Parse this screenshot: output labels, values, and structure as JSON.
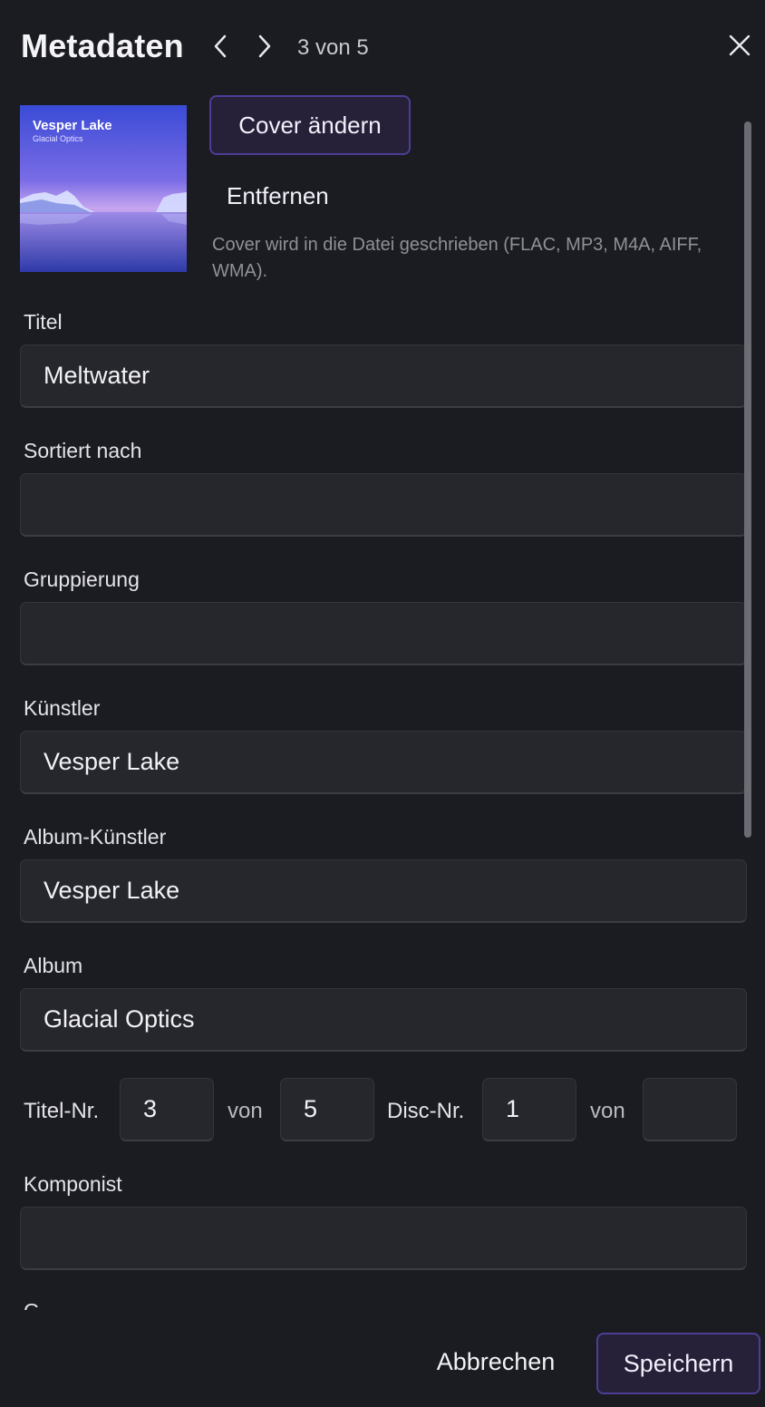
{
  "header": {
    "title": "Metadaten",
    "counter": "3 von 5"
  },
  "cover": {
    "art_title": "Vesper Lake",
    "art_subtitle": "Glacial Optics",
    "change_label": "Cover ändern",
    "remove_label": "Entfernen",
    "hint": "Cover wird in die Datei geschrieben (FLAC, MP3, M4A, AIFF, WMA)."
  },
  "fields": {
    "title": {
      "label": "Titel",
      "value": "Meltwater"
    },
    "sort_by": {
      "label": "Sortiert nach",
      "value": ""
    },
    "grouping": {
      "label": "Gruppierung",
      "value": ""
    },
    "artist": {
      "label": "Künstler",
      "value": "Vesper Lake"
    },
    "album_artist": {
      "label": "Album-Künstler",
      "value": "Vesper Lake"
    },
    "album": {
      "label": "Album",
      "value": "Glacial Optics"
    },
    "composer": {
      "label": "Komponist",
      "value": ""
    },
    "genre_partial": {
      "label": "G"
    }
  },
  "numbers": {
    "track_label": "Titel-Nr.",
    "track_value": "3",
    "of_label": "von",
    "track_total": "5",
    "disc_label": "Disc-Nr.",
    "disc_value": "1",
    "disc_total": ""
  },
  "footer": {
    "cancel_label": "Abbrechen",
    "save_label": "Speichern"
  },
  "colors": {
    "background": "#1b1c21",
    "field": "#26272d",
    "accent_border": "#4e3d96"
  }
}
